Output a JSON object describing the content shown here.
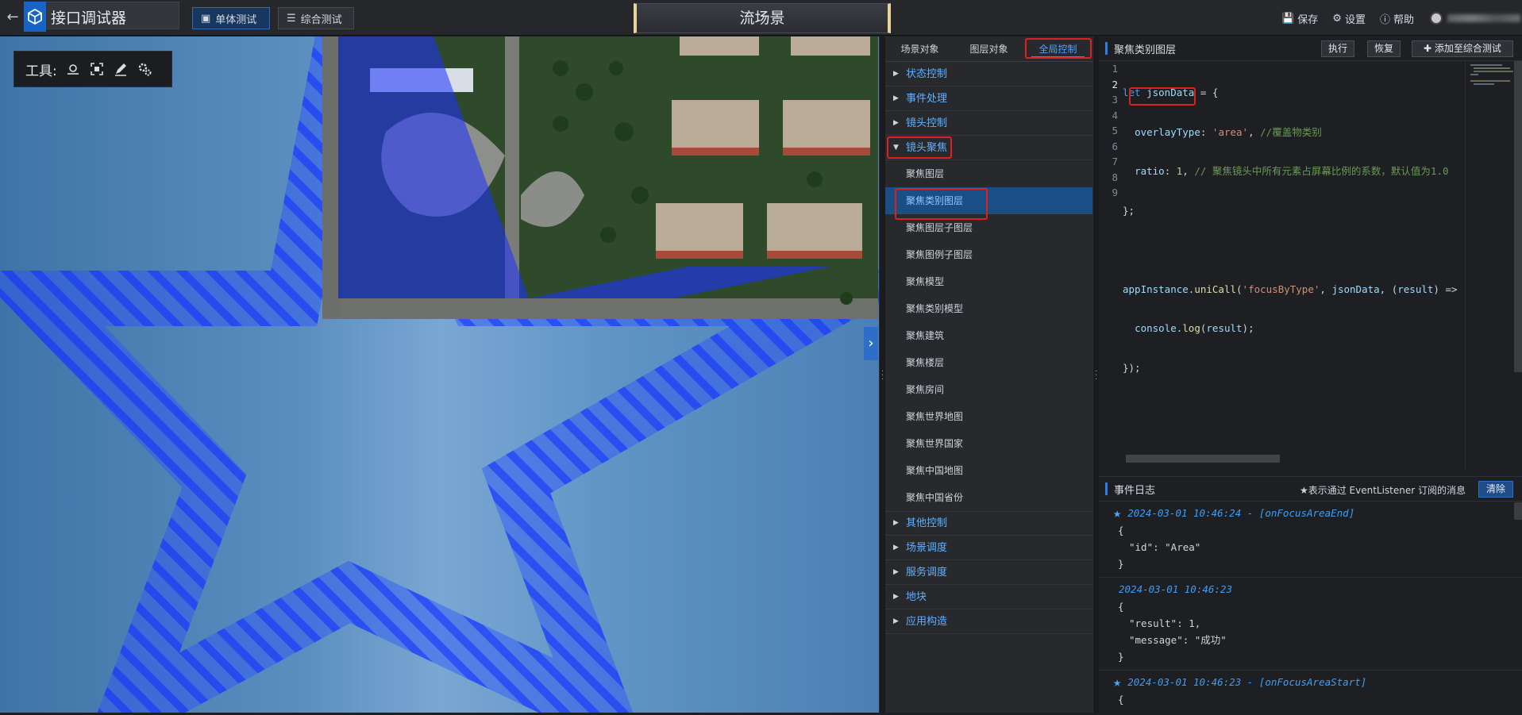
{
  "app": {
    "title": "接口调试器"
  },
  "modes": [
    {
      "label": "单体测试",
      "active": true
    },
    {
      "label": "综合测试",
      "active": false
    }
  ],
  "scene": {
    "title": "流场景"
  },
  "top_actions": [
    {
      "icon": "save-icon",
      "label": "保存"
    },
    {
      "icon": "gear-icon",
      "label": "设置"
    },
    {
      "icon": "help-icon",
      "label": "帮助"
    }
  ],
  "tools": {
    "label": "工具:"
  },
  "tabs": [
    {
      "label": "场景对象"
    },
    {
      "label": "图层对象"
    },
    {
      "label": "全局控制",
      "active": true
    }
  ],
  "nav": {
    "categories_top": [
      "状态控制",
      "事件处理",
      "镜头控制"
    ],
    "expanded": "镜头聚焦",
    "sub_items": [
      "聚焦图层",
      "聚焦类别图层",
      "聚焦图层子图层",
      "聚焦图例子图层",
      "聚焦模型",
      "聚焦类别模型",
      "聚焦建筑",
      "聚焦楼层",
      "聚焦房间",
      "聚焦世界地图",
      "聚焦世界国家",
      "聚焦中国地图",
      "聚焦中国省份"
    ],
    "selected": "聚焦类别图层",
    "categories_bottom": [
      "其他控制",
      "场景调度",
      "服务调度",
      "地块",
      "应用构造"
    ]
  },
  "editor": {
    "title": "聚焦类别图层",
    "buttons": {
      "run": "执行",
      "reset": "恢复",
      "add": "添加至综合测试"
    },
    "line_numbers": [
      "1",
      "2",
      "3",
      "4",
      "5",
      "6",
      "7",
      "8",
      "9"
    ]
  },
  "log": {
    "title": "事件日志",
    "legend": "★表示通过 EventListener 订阅的消息",
    "clear": "清除",
    "entries": [
      {
        "time": "2024-03-01 10:46:24 - [onFocusAreaEnd]",
        "starred": true,
        "lines": [
          "{",
          "\"id\": \"Area\"",
          "}"
        ]
      },
      {
        "time": "2024-03-01 10:46:23",
        "starred": false,
        "lines": [
          "{",
          "\"result\": 1,",
          "\"message\": \"成功\"",
          "}"
        ]
      },
      {
        "time": "2024-03-01 10:46:23 - [onFocusAreaStart]",
        "starred": true,
        "lines": [
          "{"
        ]
      }
    ]
  },
  "colors": {
    "accent": "#3a8ff0",
    "highlight": "#e02020",
    "selected_bg": "#1a4f86"
  }
}
